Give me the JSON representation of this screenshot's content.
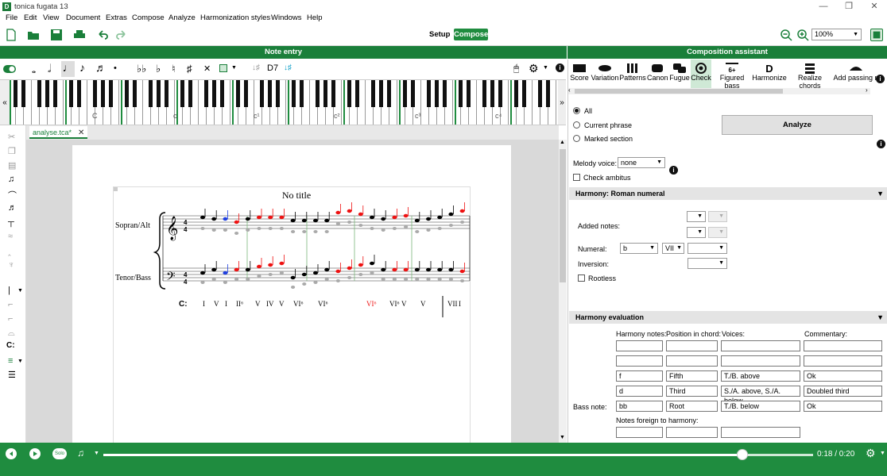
{
  "app": {
    "title": "tonica fugata 13",
    "icon_letter": "D"
  },
  "menu": [
    "File",
    "Edit",
    "View",
    "Document",
    "Extras",
    "Compose",
    "Analyze",
    "Harmonization styles",
    "Windows",
    "Help"
  ],
  "toolbar": {
    "setup_label": "Setup",
    "compose_label": "Compose",
    "zoom_value": "100%"
  },
  "panels": {
    "note_entry": "Note entry",
    "composition_assistant": "Composition assistant"
  },
  "note_entry": {
    "chord_symbol": "D7"
  },
  "keyboard": {
    "octave_labels": [
      "C",
      "c",
      "c¹",
      "c²",
      "c³",
      "c⁴"
    ]
  },
  "tab": {
    "label": "analyse.tca*"
  },
  "score": {
    "title": "No title",
    "staff1_label": "Sopran/Alt",
    "staff2_label": "Tenor/Bass",
    "time_sig": "4",
    "key_label": "C:",
    "roman_numerals": [
      {
        "t": "I",
        "c": "#000"
      },
      {
        "t": "V",
        "c": "#000"
      },
      {
        "t": "I",
        "c": "#000"
      },
      {
        "t": "II⁶",
        "c": "#000"
      },
      {
        "t": "V",
        "c": "#000"
      },
      {
        "t": "IV",
        "c": "#000"
      },
      {
        "t": "V",
        "c": "#000"
      },
      {
        "t": "VI⁶",
        "c": "#000"
      },
      {
        "t": "VI⁶",
        "c": "#000"
      },
      {
        "t": "VI⁶",
        "c": "#e11"
      },
      {
        "t": "VI⁶",
        "c": "#000"
      },
      {
        "t": "V",
        "c": "#000"
      },
      {
        "t": "V",
        "c": "#000"
      },
      {
        "t": "VII",
        "c": "#000"
      },
      {
        "t": "I",
        "c": "#000"
      }
    ]
  },
  "assistant": {
    "modes": [
      "Score",
      "Variation",
      "Patterns",
      "Canon",
      "Fugue",
      "Check",
      "Figured bass",
      "Harmonize",
      "Realize chords",
      "Add passing n"
    ],
    "active_mode": "Check",
    "figured_bass_glyph": "6+",
    "harmonize_glyph": "D",
    "scope_options": [
      "All",
      "Current phrase",
      "Marked section"
    ],
    "selected_scope": "All",
    "analyze_button": "Analyze",
    "melody_voice_label": "Melody voice:",
    "melody_voice_value": "none",
    "check_ambitus_label": "Check ambitus",
    "harmony_section": "Harmony: Roman numeral",
    "added_notes_label": "Added notes:",
    "numeral_label": "Numeral:",
    "numeral_accidental": "b",
    "numeral_value": "VII",
    "inversion_label": "Inversion:",
    "rootless_label": "Rootless",
    "evaluation_section": "Harmony evaluation",
    "columns": [
      "Harmony notes:",
      "Position in chord:",
      "Voices:",
      "Commentary:"
    ],
    "rows": [
      [
        "",
        "",
        "",
        ""
      ],
      [
        "",
        "",
        "",
        ""
      ],
      [
        "f",
        "Fifth",
        "T./B. above",
        "Ok"
      ],
      [
        "d",
        "Third",
        "S./A. above, S./A. below",
        "Doubled third"
      ],
      [
        "bb",
        "Root",
        "T./B. below",
        "Ok"
      ]
    ],
    "bass_note_label": "Bass note:",
    "foreign_label": "Notes foreign to harmony:"
  },
  "player": {
    "time": "0:18 / 0:20",
    "progress": 0.9,
    "solo_label": "Solo"
  },
  "colors": {
    "accent": "#1f8c3f",
    "dark_accent": "#1a7f3a",
    "flagged": "#e11",
    "selected": "#1f3fe0"
  }
}
